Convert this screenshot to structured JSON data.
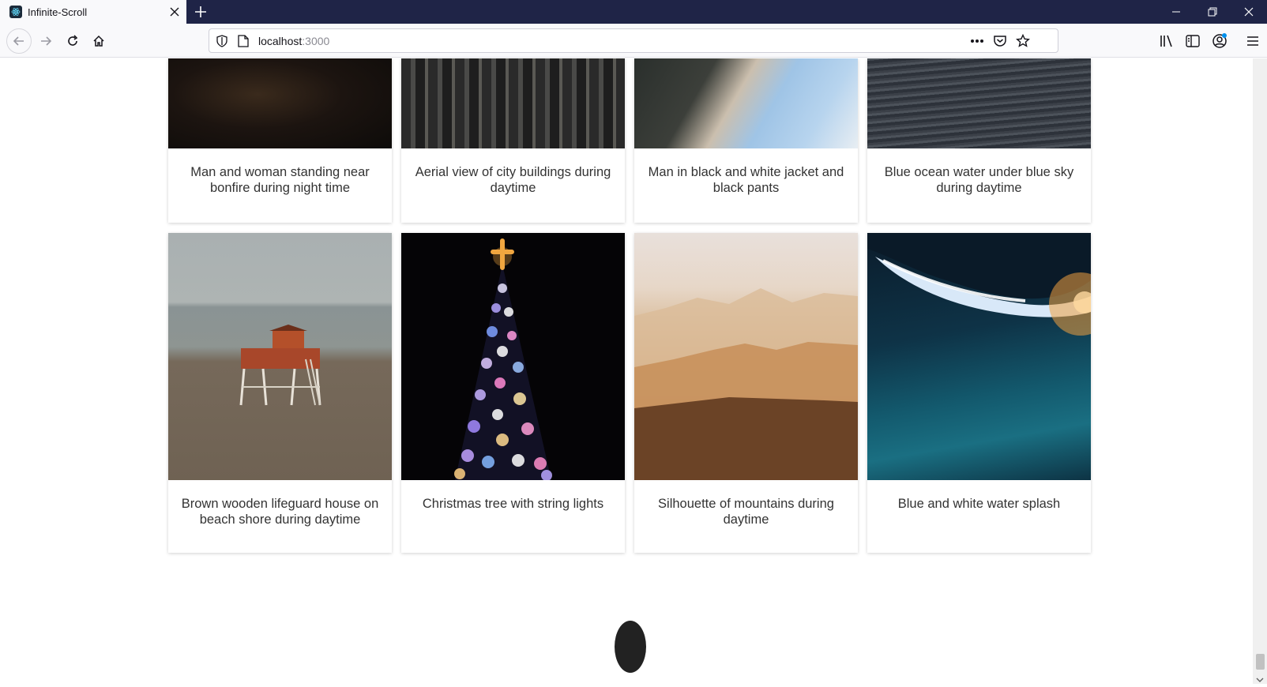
{
  "browser": {
    "tab_title": "Infinite-Scroll",
    "url_host": "localhost",
    "url_port": ":3000"
  },
  "cards_top": [
    {
      "caption": "Man and woman standing near bonfire during night time"
    },
    {
      "caption": "Aerial view of city buildings during daytime"
    },
    {
      "caption": "Man in black and white jacket and black pants"
    },
    {
      "caption": "Blue ocean water under blue sky during daytime"
    }
  ],
  "cards_bottom": [
    {
      "caption": "Brown wooden lifeguard house on beach shore during daytime"
    },
    {
      "caption": "Christmas tree with string lights"
    },
    {
      "caption": "Silhouette of mountains during daytime"
    },
    {
      "caption": "Blue and white water splash"
    }
  ],
  "colors": {
    "titlebar": "#1f2447",
    "toolbar": "#f9f9fb",
    "caption_text": "#333333",
    "loader": "#222222"
  }
}
